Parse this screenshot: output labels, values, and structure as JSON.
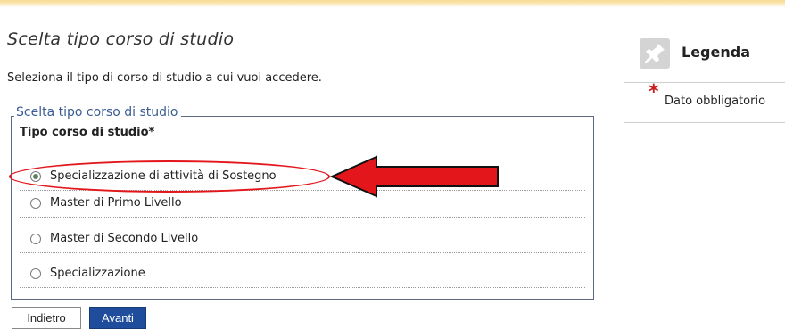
{
  "page": {
    "title": "Scelta tipo corso di studio",
    "description": "Seleziona il tipo di corso di studio a cui vuoi accedere."
  },
  "form": {
    "legend": "Scelta tipo corso di studio",
    "field_label": "Tipo corso di studio*",
    "options": [
      {
        "label": "Specializzazione di attività di Sostegno",
        "selected": true
      },
      {
        "label": "Master di Primo Livello",
        "selected": false
      },
      {
        "label": "Master di Secondo Livello",
        "selected": false
      },
      {
        "label": "Specializzazione",
        "selected": false
      }
    ]
  },
  "buttons": {
    "back_label": "Indietro",
    "next_label": "Avanti"
  },
  "legend_panel": {
    "title": "Legenda",
    "required_marker": "*",
    "required_label": "Dato obbligatorio"
  },
  "annotation": {
    "highlight_color": "#e3161b"
  },
  "colors": {
    "primary_button": "#1f4d9b",
    "legend_text": "#3b5d93",
    "required_star": "#cc1a1a"
  }
}
